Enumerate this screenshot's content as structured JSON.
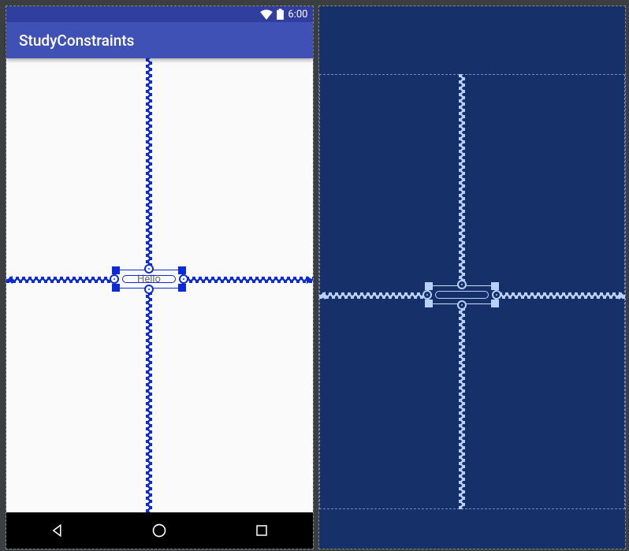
{
  "status": {
    "time": "6:00"
  },
  "app": {
    "title": "StudyConstraints"
  },
  "widget": {
    "text": "Hello"
  },
  "blueprint_widget": {
    "text": ""
  }
}
